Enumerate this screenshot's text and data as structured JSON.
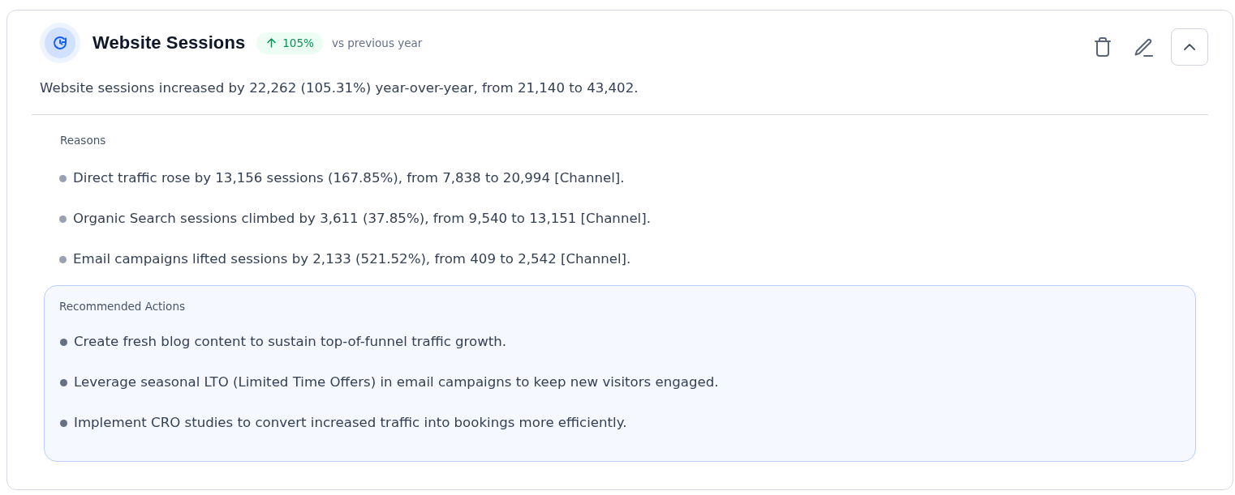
{
  "metric": {
    "title": "Website Sessions",
    "change": {
      "kind": "increase",
      "value": "105%"
    },
    "comparison": "vs previous year",
    "summary": "Website sessions increased by 22,262 (105.31%) year-over-year, from 21,140 to 43,402.",
    "expanded": true
  },
  "reasons": {
    "title": "Reasons",
    "items": [
      "Direct traffic rose by 13,156 sessions (167.85%), from 7,838 to 20,994 [Channel].",
      "Organic Search sessions climbed by 3,611 (37.85%), from 9,540 to 13,151 [Channel].",
      "Email campaigns lifted sessions by 2,133 (521.52%), from 409 to 2,542 [Channel]."
    ]
  },
  "recommended_actions": {
    "title": "Recommended Actions",
    "items": [
      "Create fresh blog content to sustain top-of-funnel traffic growth.",
      "Leverage seasonal LTO (Limited Time Offers) in email campaigns to keep new visitors engaged.",
      "Implement CRO studies to convert increased traffic into bookings more efficiently."
    ]
  }
}
